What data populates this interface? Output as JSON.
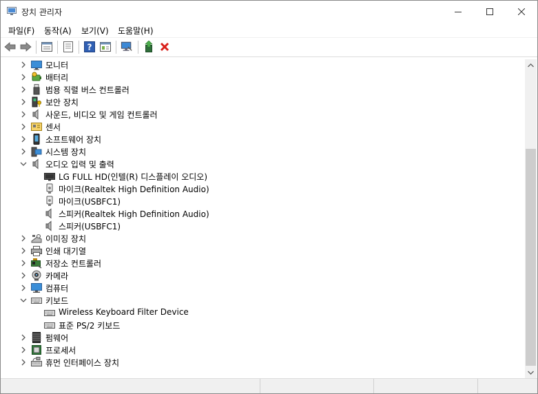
{
  "window": {
    "title": "장치 관리자",
    "controls": [
      "minimize",
      "maximize",
      "close"
    ]
  },
  "menu": [
    {
      "label": "파일(F)"
    },
    {
      "label": "동작(A)"
    },
    {
      "label": "보기(V)"
    },
    {
      "label": "도움말(H)"
    }
  ],
  "toolbar": [
    {
      "icon": "back-arrow-icon"
    },
    {
      "icon": "forward-arrow-icon"
    },
    {
      "icon": "properties-icon"
    },
    {
      "icon": "show-hidden-icon"
    },
    {
      "icon": "help-icon"
    },
    {
      "icon": "view-resources-icon"
    },
    {
      "icon": "scan-hardware-icon"
    },
    {
      "icon": "update-driver-icon"
    },
    {
      "icon": "uninstall-device-icon"
    }
  ],
  "tree": [
    {
      "label": "모니터",
      "depth": 0,
      "state": "collapsed",
      "icon": "monitor-icon"
    },
    {
      "label": "배터리",
      "depth": 0,
      "state": "collapsed",
      "icon": "battery-icon"
    },
    {
      "label": "범용 직렬 버스 컨트롤러",
      "depth": 0,
      "state": "collapsed",
      "icon": "usb-icon"
    },
    {
      "label": "보안 장치",
      "depth": 0,
      "state": "collapsed",
      "icon": "security-device-icon"
    },
    {
      "label": "사운드, 비디오 및 게임 컨트롤러",
      "depth": 0,
      "state": "collapsed",
      "icon": "speaker-icon"
    },
    {
      "label": "센서",
      "depth": 0,
      "state": "collapsed",
      "icon": "sensor-icon"
    },
    {
      "label": "소프트웨어 장치",
      "depth": 0,
      "state": "collapsed",
      "icon": "software-device-icon"
    },
    {
      "label": "시스템 장치",
      "depth": 0,
      "state": "collapsed",
      "icon": "system-device-icon"
    },
    {
      "label": "오디오 입력 및 출력",
      "depth": 0,
      "state": "expanded",
      "icon": "speaker-icon"
    },
    {
      "label": "LG FULL HD(인텔(R) 디스플레이 오디오)",
      "depth": 1,
      "state": "leaf",
      "icon": "display-audio-icon"
    },
    {
      "label": "마이크(Realtek High Definition Audio)",
      "depth": 1,
      "state": "leaf",
      "icon": "microphone-icon"
    },
    {
      "label": "마이크(USBFC1)",
      "depth": 1,
      "state": "leaf",
      "icon": "microphone-icon"
    },
    {
      "label": "스피커(Realtek High Definition Audio)",
      "depth": 1,
      "state": "leaf",
      "icon": "speaker-icon"
    },
    {
      "label": "스피커(USBFC1)",
      "depth": 1,
      "state": "leaf",
      "icon": "speaker-icon"
    },
    {
      "label": "이미징 장치",
      "depth": 0,
      "state": "collapsed",
      "icon": "imaging-device-icon"
    },
    {
      "label": "인쇄 대기열",
      "depth": 0,
      "state": "collapsed",
      "icon": "printer-icon"
    },
    {
      "label": "저장소 컨트롤러",
      "depth": 0,
      "state": "collapsed",
      "icon": "storage-controller-icon"
    },
    {
      "label": "카메라",
      "depth": 0,
      "state": "collapsed",
      "icon": "camera-icon"
    },
    {
      "label": "컴퓨터",
      "depth": 0,
      "state": "collapsed",
      "icon": "computer-icon"
    },
    {
      "label": "키보드",
      "depth": 0,
      "state": "expanded",
      "icon": "keyboard-icon"
    },
    {
      "label": "Wireless Keyboard Filter Device",
      "depth": 1,
      "state": "leaf",
      "icon": "keyboard-icon"
    },
    {
      "label": "표준 PS/2 키보드",
      "depth": 1,
      "state": "leaf",
      "icon": "keyboard-icon"
    },
    {
      "label": "펌웨어",
      "depth": 0,
      "state": "collapsed",
      "icon": "firmware-icon"
    },
    {
      "label": "프로세서",
      "depth": 0,
      "state": "collapsed",
      "icon": "processor-icon"
    },
    {
      "label": "휴먼 인터페이스 장치",
      "depth": 0,
      "state": "collapsed",
      "icon": "hid-icon"
    }
  ],
  "colors": {
    "window_bg": "#ffffff",
    "toolbar_border": "#dcdcdc",
    "scrollbar_track": "#f0f0f0",
    "scrollbar_thumb": "#cdcdcd",
    "delete_red": "#d9201b",
    "monitor_blue": "#3b8ed8"
  }
}
